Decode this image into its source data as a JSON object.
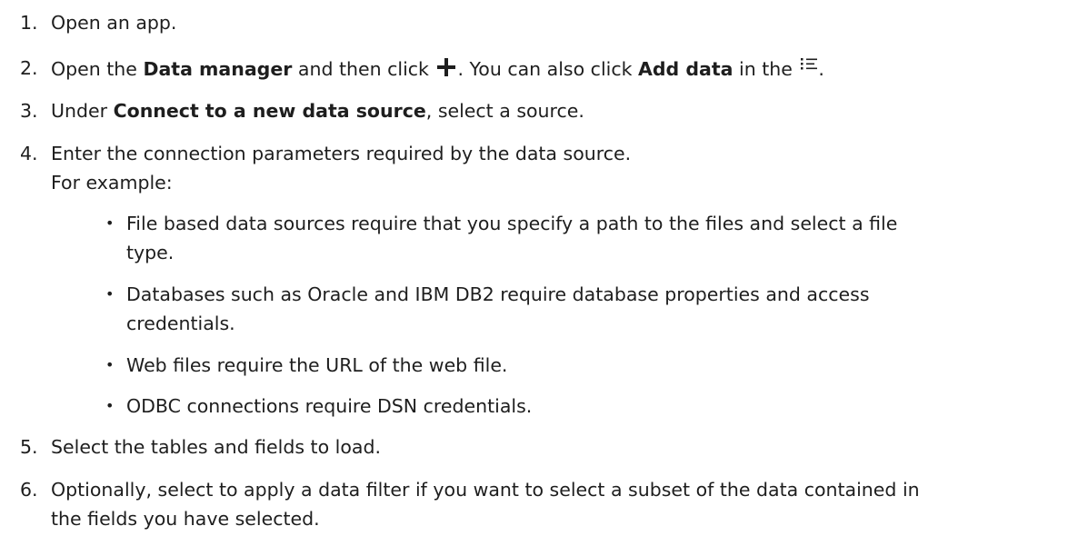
{
  "steps": [
    {
      "num": "1.",
      "text": "Open an app."
    },
    {
      "num": "2.",
      "part1": "Open the ",
      "bold1": "Data manager",
      "part2": " and then click ",
      "part3": ". You can also click ",
      "bold2": "Add data",
      "part4": " in the ",
      "part5": "."
    },
    {
      "num": "3.",
      "part1": "Under ",
      "bold1": "Connect to a new data source",
      "part2": ", select a source."
    },
    {
      "num": "4.",
      "line1": "Enter the connection parameters required by the data source.",
      "line2": "For example:",
      "bullets": [
        {
          "line1": "File based data sources require that you specify a path to the files and select a file",
          "line2": "type."
        },
        {
          "line1": "Databases such as Oracle and IBM DB2 require database properties and access",
          "line2": "credentials."
        },
        {
          "line1": "Web files require the URL of the web file."
        },
        {
          "line1": "ODBC connections require DSN credentials."
        }
      ]
    },
    {
      "num": "5.",
      "text": "Select the tables and fields to load."
    },
    {
      "num": "6.",
      "line1": "Optionally, select to apply a data filter if you want to select a subset of the data contained in",
      "line2": "the fields you have selected."
    }
  ],
  "bullet_char": "•"
}
